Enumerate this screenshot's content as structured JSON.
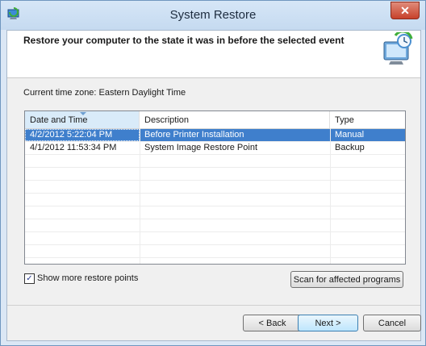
{
  "window": {
    "title": "System Restore",
    "close_label": "✕"
  },
  "header": {
    "instruction": "Restore your computer to the state it was in before the selected event"
  },
  "timezone_label": "Current time zone: Eastern Daylight Time",
  "list": {
    "columns": [
      "Date and Time",
      "Description",
      "Type"
    ],
    "rows": [
      {
        "date": "4/2/2012 5:22:04 PM",
        "description": "Before Printer Installation",
        "type": "Manual",
        "selected": true
      },
      {
        "date": "4/1/2012 11:53:34 PM",
        "description": "System Image Restore Point",
        "type": "Backup",
        "selected": false
      }
    ]
  },
  "options": {
    "show_more_label": "Show more restore points",
    "show_more_checked": true
  },
  "buttons": {
    "scan": "Scan for affected programs",
    "back": "< Back",
    "next": "Next >",
    "cancel": "Cancel"
  },
  "colors": {
    "selection": "#3f7fcc",
    "title_bar": "#c5daf0",
    "close": "#c7412b"
  },
  "icons": {
    "app": "system-restore-icon",
    "header": "restore-monitor-icon"
  }
}
